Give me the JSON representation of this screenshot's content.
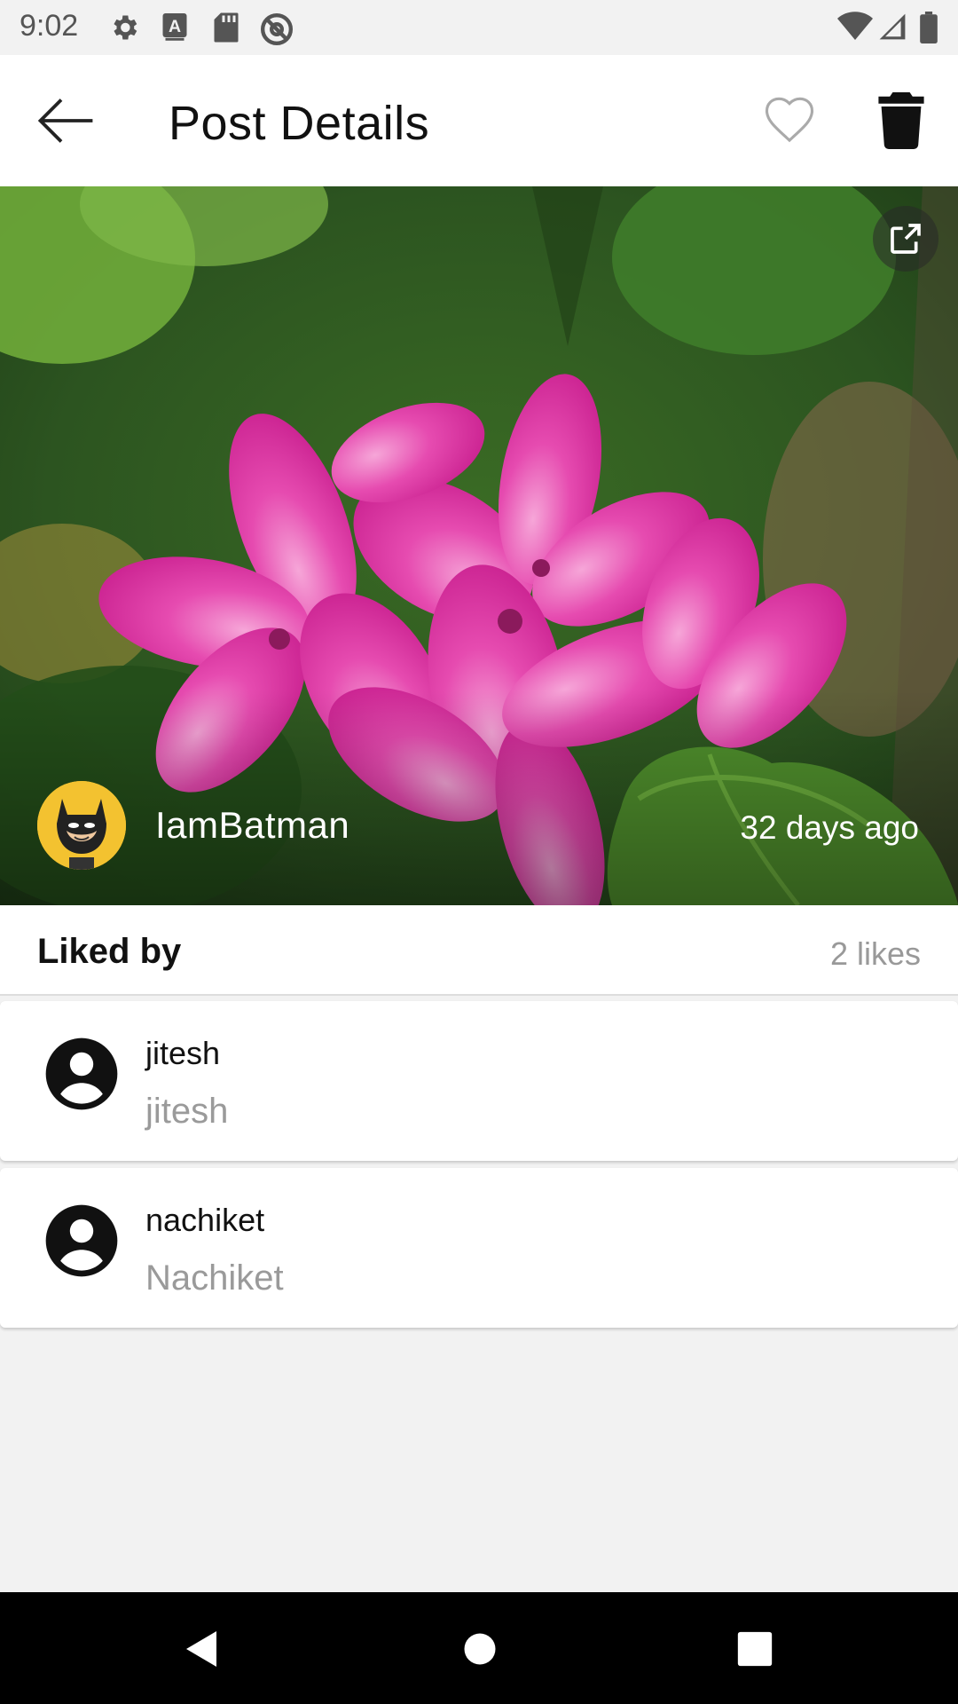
{
  "status_bar": {
    "time": "9:02",
    "left_icons": [
      "settings-icon",
      "keyboard-a-icon",
      "sd-card-icon",
      "at-sign-icon"
    ],
    "right_icons": [
      "wifi-icon",
      "signal-icon",
      "battery-icon"
    ]
  },
  "app_bar": {
    "title": "Post Details",
    "back_icon": "arrow-back-icon",
    "like_icon": "heart-outline-icon",
    "delete_icon": "trash-icon"
  },
  "post": {
    "image_subject": "pink-flower-photo",
    "open_icon": "open-external-icon",
    "author": "IamBatman",
    "time_ago": "32 days ago"
  },
  "likes": {
    "header": "Liked by",
    "count_text": "2 likes",
    "users": [
      {
        "username": "jitesh",
        "name": "jitesh"
      },
      {
        "username": "nachiket",
        "name": "Nachiket"
      }
    ]
  },
  "nav_bar": {
    "icons": [
      "nav-back-icon",
      "nav-home-icon",
      "nav-recents-icon"
    ]
  },
  "colors": {
    "accent_pink": "#e0329f",
    "leaf_green": "#4f8f2c",
    "secondary_text": "#9a9a9a"
  }
}
